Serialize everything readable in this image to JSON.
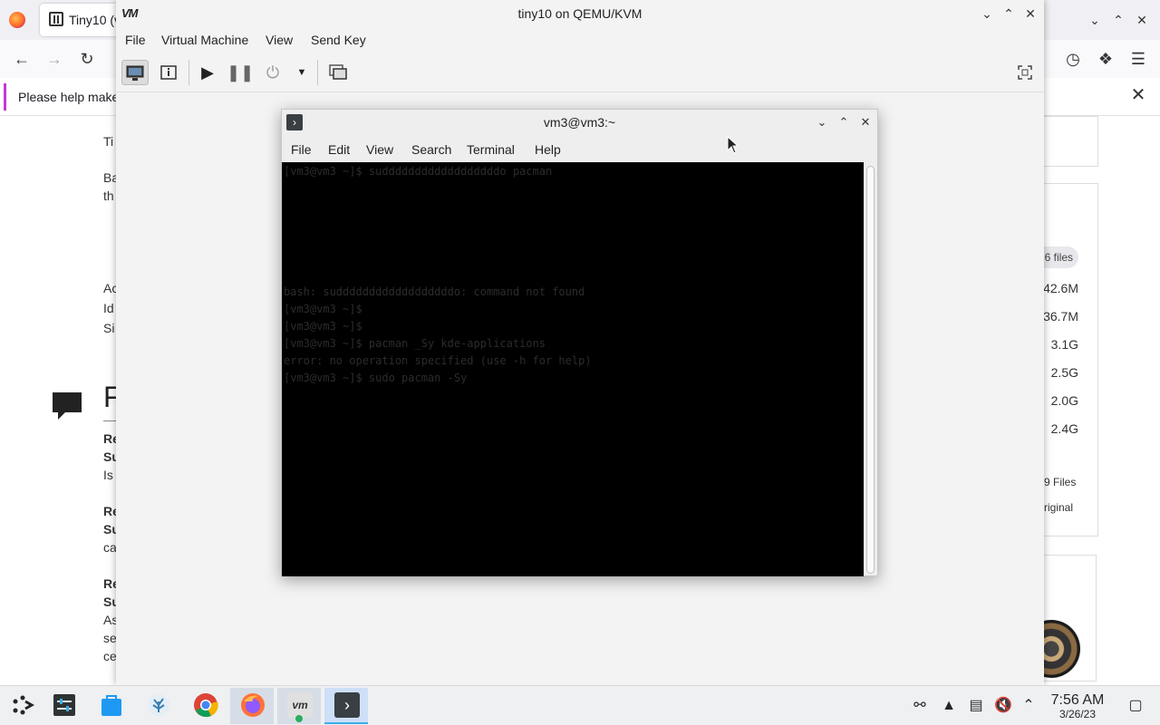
{
  "firefox": {
    "tab_title": "Tiny10 (v",
    "notification_text": "Please help make",
    "page": {
      "intro_lines": [
        "Ti",
        "Ba",
        "th"
      ],
      "info_lines": [
        "Ac",
        "Id",
        "Si"
      ],
      "section_heading": "F",
      "comments": [
        {
          "line1": "Re",
          "line2": "Su",
          "line3": "Is"
        },
        {
          "line1": "Re",
          "line2": "Su",
          "line3": "ca"
        },
        {
          "line1": "Re",
          "line2": "Su",
          "line3": "As",
          "line4": "se",
          "line5": "ce"
        }
      ],
      "sidebar": {
        "files_badge": "6 files",
        "sizes": [
          "42.6M",
          "36.7M",
          "3.1G",
          "2.5G",
          "2.0G",
          "2.4G"
        ],
        "files_link": "9 Files",
        "original_link": "riginal"
      }
    }
  },
  "vm_window": {
    "logo": "VM",
    "title": "tiny10 on QEMU/KVM",
    "menu": [
      "File",
      "Virtual Machine",
      "View",
      "Send Key"
    ]
  },
  "terminal": {
    "title": "vm3@vm3:~",
    "menu": [
      "File",
      "Edit",
      "View",
      "Search",
      "Terminal",
      "Help"
    ],
    "lines": [
      "[vm3@vm3 ~]$ suddddddddddddddddddo pacman",
      "",
      "",
      "",
      "",
      "",
      "",
      "bash: suddddddddddddddddddo: command not found",
      "[vm3@vm3 ~]$",
      "[vm3@vm3 ~]$",
      "[vm3@vm3 ~]$ pacman _Sy kde-applications",
      "error: no operation specified (use -h for help)",
      "[vm3@vm3 ~]$ sudo pacman -Sy"
    ]
  },
  "taskbar": {
    "clock_time": "7:56 AM",
    "clock_date": "3/26/23",
    "vm_icon_label": "vm"
  }
}
